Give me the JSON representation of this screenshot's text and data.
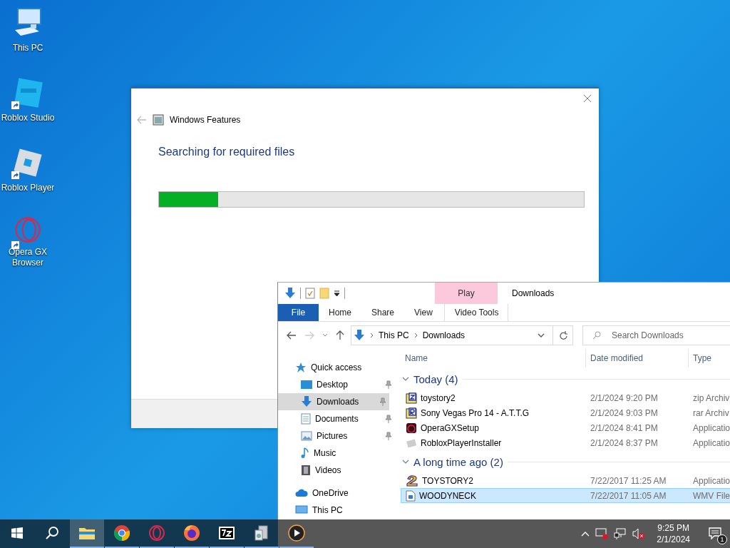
{
  "desktop_icons": [
    {
      "label": "This PC",
      "kind": "computer",
      "shortcut": false
    },
    {
      "label": "Roblox Studio",
      "kind": "studio",
      "shortcut": true
    },
    {
      "label": "Roblox Player",
      "kind": "player",
      "shortcut": true
    },
    {
      "label": "Opera GX Browser",
      "kind": "opera",
      "shortcut": true
    }
  ],
  "features_dialog": {
    "title": "Windows Features",
    "heading": "Searching for required files",
    "progress": {
      "level": 0.14
    }
  },
  "explorer": {
    "title": "Downloads",
    "contextual_header": "Play",
    "ribbon_tabs": [
      {
        "label": "File",
        "kind": "file"
      },
      {
        "label": "Home",
        "kind": "tab"
      },
      {
        "label": "Share",
        "kind": "tab"
      },
      {
        "label": "View",
        "kind": "tab"
      },
      {
        "label": "Video Tools",
        "kind": "contextual"
      }
    ],
    "breadcrumb": [
      "This PC",
      "Downloads"
    ],
    "search": {
      "placeholder": "Search Downloads"
    },
    "columns": [
      "Name",
      "Date modified",
      "Type"
    ],
    "nav": [
      {
        "label": "Quick access",
        "kind": "star",
        "selected": false,
        "children": [
          {
            "label": "Desktop",
            "kind": "desktop",
            "selected": false,
            "pinned": true
          },
          {
            "label": "Downloads",
            "kind": "downloads",
            "selected": true,
            "pinned": true
          },
          {
            "label": "Documents",
            "kind": "documents",
            "selected": false,
            "pinned": true
          },
          {
            "label": "Pictures",
            "kind": "pictures",
            "selected": false,
            "pinned": true
          },
          {
            "label": "Music",
            "kind": "music",
            "selected": false,
            "pinned": false
          },
          {
            "label": "Videos",
            "kind": "videos",
            "selected": false,
            "pinned": false
          }
        ]
      },
      {
        "label": "OneDrive",
        "kind": "cloud",
        "selected": false
      },
      {
        "label": "This PC",
        "kind": "pc",
        "selected": false
      }
    ],
    "groups": [
      {
        "label": "Today (4)",
        "expanded": true,
        "files": [
          {
            "name": "toystory2",
            "kind": "zip",
            "date": "2/1/2024 9:20 PM",
            "type": "zip Archiv",
            "selected": false
          },
          {
            "name": "Sony Vegas Pro 14 - A.T.T.G",
            "kind": "rar",
            "date": "2/1/2024 9:03 PM",
            "type": "rar Archiv",
            "selected": false
          },
          {
            "name": "OperaGXSetup",
            "kind": "opera",
            "date": "2/1/2024 8:41 PM",
            "type": "Applicatio",
            "selected": false
          },
          {
            "name": "RobloxPlayerInstaller",
            "kind": "roblox",
            "date": "2/1/2024 8:37 PM",
            "type": "Applicatio",
            "selected": false
          }
        ]
      },
      {
        "label": "A long time ago (2)",
        "expanded": true,
        "files": [
          {
            "name": "TOYSTORY2",
            "kind": "two",
            "date": "7/22/2017 11:25 AM",
            "type": "Applicatio",
            "selected": false
          },
          {
            "name": "WOODYNECK",
            "kind": "video",
            "date": "7/22/2017 11:05 AM",
            "type": "WMV File",
            "selected": true
          }
        ]
      }
    ]
  },
  "taskbar": {
    "apps": [
      {
        "kind": "explorer",
        "active": true
      },
      {
        "kind": "chrome",
        "active": false
      },
      {
        "kind": "opera",
        "active": false
      },
      {
        "kind": "firefox",
        "active": false
      },
      {
        "kind": "sevenzip",
        "active": false
      },
      {
        "kind": "installer",
        "active": false
      },
      {
        "kind": "media",
        "active": false
      }
    ],
    "time": "9:25 PM",
    "date": "2/1/2024",
    "notifications": "1"
  }
}
